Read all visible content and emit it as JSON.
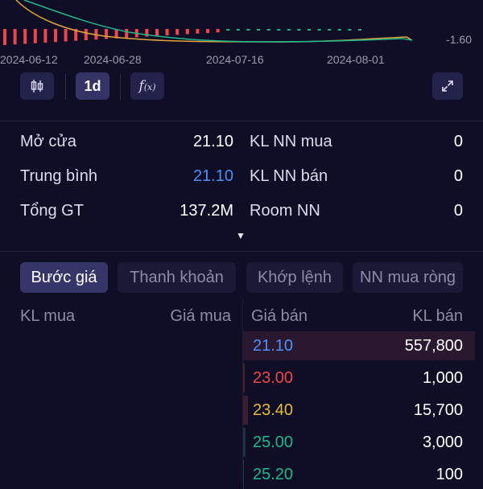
{
  "chart": {
    "dates": [
      "2024-06-12",
      "2024-06-28",
      "2024-07-16",
      "2024-08-01"
    ],
    "axis_value": "-1.60",
    "colors": {
      "line_teal": "#1fb88a",
      "line_orange": "#e0a43b",
      "bar_red": "#f0454a",
      "bar_green": "#1fb88a"
    }
  },
  "toolbar": {
    "candle_icon": "candlestick-icon",
    "interval": "1d",
    "indicator_icon": "function-icon",
    "expand_icon": "expand-icon"
  },
  "stats": {
    "left": [
      {
        "label": "Mở cửa",
        "value": "21.10"
      },
      {
        "label": "Trung bình",
        "value": "21.10"
      },
      {
        "label": "Tổng GT",
        "value": "137.2M"
      }
    ],
    "right": [
      {
        "label": "KL NN mua",
        "value": "0"
      },
      {
        "label": "KL NN bán",
        "value": "0"
      },
      {
        "label": "Room NN",
        "value": "0"
      }
    ],
    "expand_glyph": "▼"
  },
  "tabs": [
    "Bước giá",
    "Thanh khoản",
    "Khớp lệnh",
    "NN mua ròng"
  ],
  "orderbook": {
    "headers": {
      "buy_vol": "KL mua",
      "buy_price": "Giá mua",
      "sell_price": "Giá bán",
      "sell_vol": "KL bán"
    },
    "asks": [
      {
        "price": "21.10",
        "volume": "557,800",
        "color": "#4f8ff7"
      },
      {
        "price": "23.00",
        "volume": "1,000",
        "color": "#f0454a"
      },
      {
        "price": "23.40",
        "volume": "15,700",
        "color": "#e6b93c"
      },
      {
        "price": "25.00",
        "volume": "3,000",
        "color": "#1fb88a"
      },
      {
        "price": "25.20",
        "volume": "100",
        "color": "#1fb88a"
      }
    ]
  }
}
